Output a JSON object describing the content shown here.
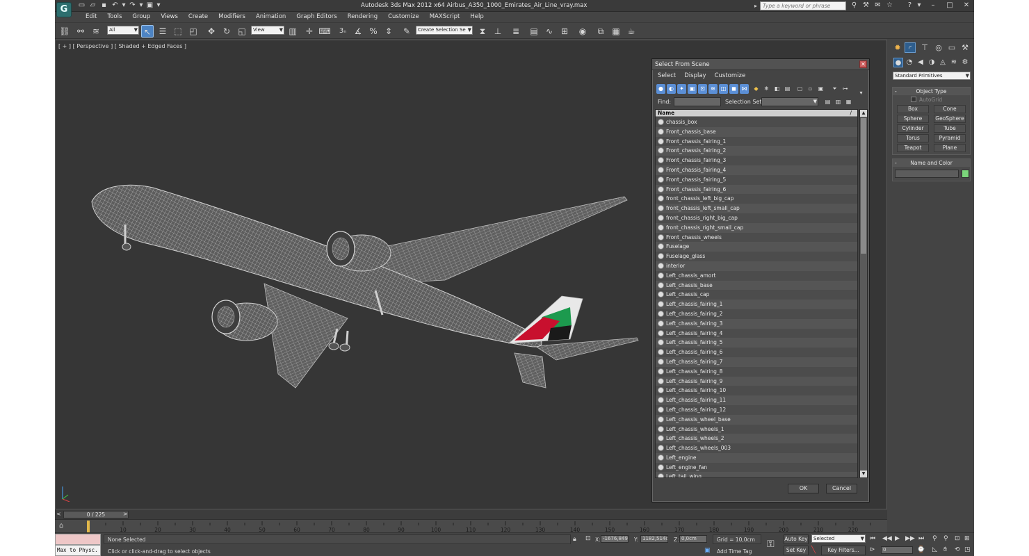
{
  "app": {
    "title": "Autodesk 3ds Max  2012 x64      Airbus_A350_1000_Emirates_Air_Line_vray.max",
    "search_placeholder": "Type a keyword or phrase"
  },
  "menu": [
    "Edit",
    "Tools",
    "Group",
    "Views",
    "Create",
    "Modifiers",
    "Animation",
    "Graph Editors",
    "Rendering",
    "Customize",
    "MAXScript",
    "Help"
  ],
  "toolbar": {
    "selection_filter": "All",
    "reference_coord": "View",
    "named_selection": "Create Selection Se",
    "snap_label": "3"
  },
  "viewport": {
    "label": "[ + ] [ Perspective ] [ Shaded + Edged Faces ]"
  },
  "command_panel": {
    "category": "Standard Primitives",
    "object_type_title": "Object Type",
    "autogrid_label": "AutoGrid",
    "buttons": [
      "Box",
      "Cone",
      "Sphere",
      "GeoSphere",
      "Cylinder",
      "Tube",
      "Torus",
      "Pyramid",
      "Teapot",
      "Plane"
    ],
    "name_color_title": "Name and Color",
    "object_color": "#7bd67b"
  },
  "dialog": {
    "title": "Select From Scene",
    "menu": [
      "Select",
      "Display",
      "Customize"
    ],
    "find_label": "Find:",
    "selection_set_label": "Selection Set:",
    "column_name": "Name",
    "items": [
      "chassis_box",
      "Front_chassis_base",
      "Front_chassis_fairing_1",
      "Front_chassis_fairing_2",
      "Front_chassis_fairing_3",
      "Front_chassis_fairing_4",
      "Front_chassis_fairing_5",
      "Front_chassis_fairing_6",
      "front_chassis_left_big_cap",
      "front_chassis_left_small_cap",
      "front_chassis_right_big_cap",
      "front_chassis_right_small_cap",
      "Front_chassis_wheels",
      "Fuselage",
      "Fuselage_glass",
      "interior",
      "Left_chassis_amort",
      "Left_chassis_base",
      "Left_chassis_cap",
      "Left_chassis_fairing_1",
      "Left_chassis_fairing_2",
      "Left_chassis_fairing_3",
      "Left_chassis_fairing_4",
      "Left_chassis_fairing_5",
      "Left_chassis_fairing_6",
      "Left_chassis_fairing_7",
      "Left_chassis_fairing_8",
      "Left_chassis_fairing_9",
      "Left_chassis_fairing_10",
      "Left_chassis_fairing_11",
      "Left_chassis_fairing_12",
      "Left_chassis_wheel_base",
      "Left_chassis_wheels_1",
      "Left_chassis_wheels_2",
      "Left_chassis_wheels_003",
      "Left_engine",
      "Left_engine_fan",
      "Left_tail_wing"
    ],
    "ok_label": "OK",
    "cancel_label": "Cancel"
  },
  "timeline": {
    "frame_label": "0 / 225",
    "ticks": [
      "10",
      "20",
      "30",
      "40",
      "50",
      "60",
      "70",
      "80",
      "90",
      "100",
      "110",
      "120",
      "130",
      "140",
      "150",
      "160",
      "170",
      "180",
      "190",
      "200",
      "210",
      "220"
    ]
  },
  "status": {
    "script_label": "Max to Physc.",
    "selection": "None Selected",
    "prompt": "Click or click-and-drag to select objects",
    "x_label": "X:",
    "x_value": "-1676,849c",
    "y_label": "Y:",
    "y_value": "1182,514c",
    "z_label": "Z:",
    "z_value": "0,0cm",
    "grid": "Grid = 10,0cm",
    "add_time_tag": "Add Time Tag",
    "auto_key": "Auto Key",
    "set_key": "Set Key",
    "key_mode": "Selected",
    "key_filters": "Key Filters...",
    "current_frame": "0"
  }
}
